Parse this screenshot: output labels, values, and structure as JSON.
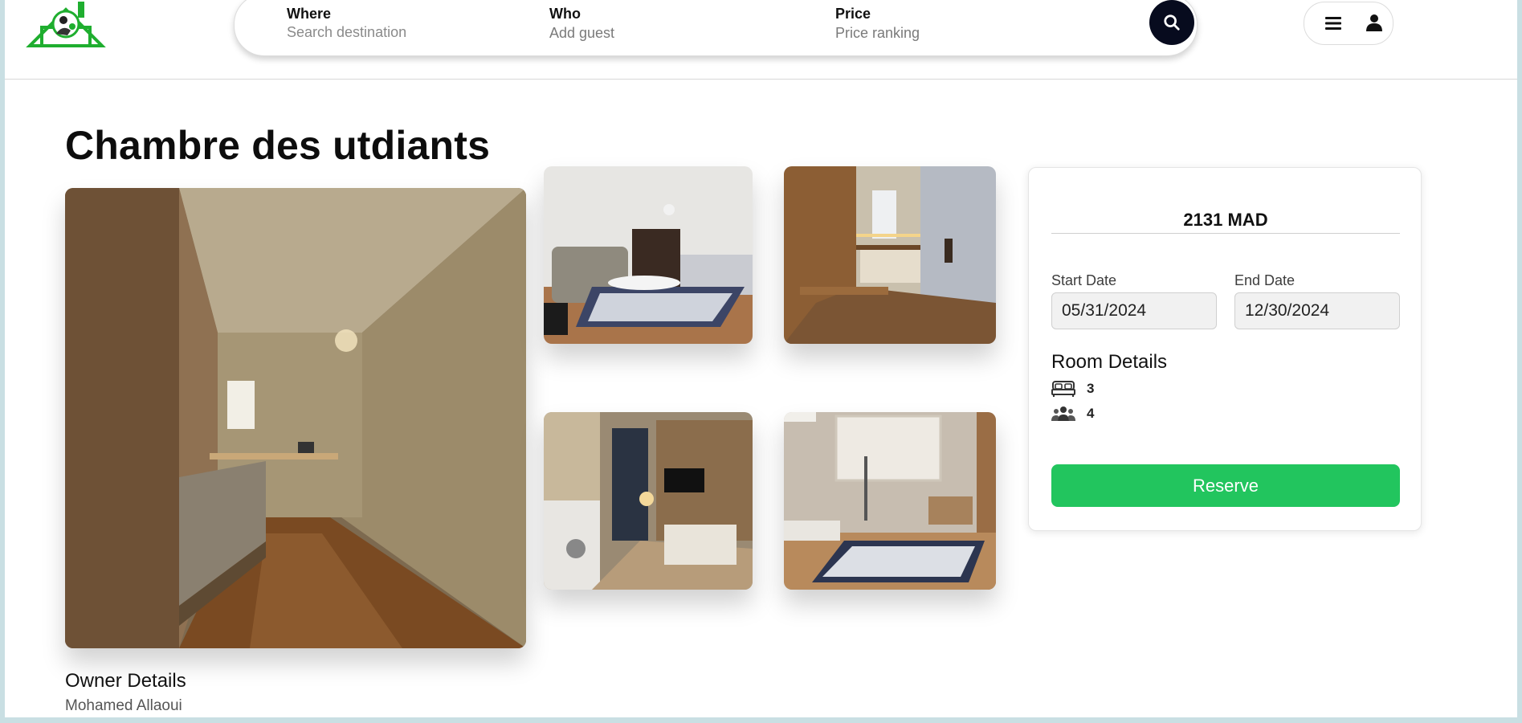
{
  "header": {
    "search": {
      "where": {
        "label": "Where",
        "placeholder": "Search destination"
      },
      "who": {
        "label": "Who",
        "value": "Add guest"
      },
      "price": {
        "label": "Price",
        "value": "Price ranking"
      }
    },
    "icons": {
      "logo": "house-logo-icon",
      "search": "search-icon",
      "menu": "hamburger-menu-icon",
      "user": "user-icon"
    }
  },
  "listing": {
    "title": "Chambre des utdiants"
  },
  "booking": {
    "price": "2131 MAD",
    "start_label": "Start Date",
    "start_value": "05/31/2024",
    "end_label": "End Date",
    "end_value": "12/30/2024",
    "room_details_title": "Room Details",
    "beds": "3",
    "guests": "4",
    "reserve_label": "Reserve"
  },
  "owner": {
    "heading": "Owner Details",
    "name": "Mohamed Allaoui"
  },
  "colors": {
    "accent_green": "#22c55e",
    "search_button": "#070b1e",
    "logo_green": "#1fae2f"
  }
}
